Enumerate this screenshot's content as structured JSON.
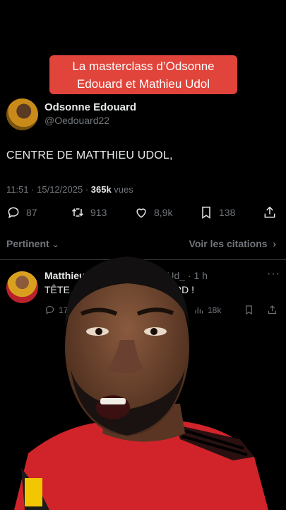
{
  "banner": {
    "line1": "La masterclass d’Odsonne",
    "line2": "Edouard et Mathieu Udol"
  },
  "tweet": {
    "author_name": "Odsonne Edouard",
    "author_handle": "@Oedouard22",
    "text": "CENTRE DE MATTHIEU UDOL,",
    "time": "11:51 · 15/12/2025 · ",
    "views_count": "365k",
    "views_label": " vues",
    "replies": "87",
    "reposts": "913",
    "likes": "8,9k",
    "bookmarks": "138"
  },
  "filters": {
    "sort": "Pertinent",
    "quotes": "Voir les citations"
  },
  "reply": {
    "author_name": "Matthieu",
    "author_handle_fragment": "atthUd_ · 1 h",
    "text_left": "TÊTE",
    "text_right": "RD !",
    "replies": "17",
    "views": "18k"
  },
  "icons": [
    "reply-icon",
    "repost-icon",
    "like-icon",
    "bookmark-icon",
    "share-icon",
    "views-icon",
    "more-icon",
    "chevron-down-icon",
    "chevron-right-icon"
  ],
  "colors": {
    "banner": "#e0443a",
    "background": "#000000",
    "muted": "#71767b",
    "text": "#e7e9ea"
  }
}
